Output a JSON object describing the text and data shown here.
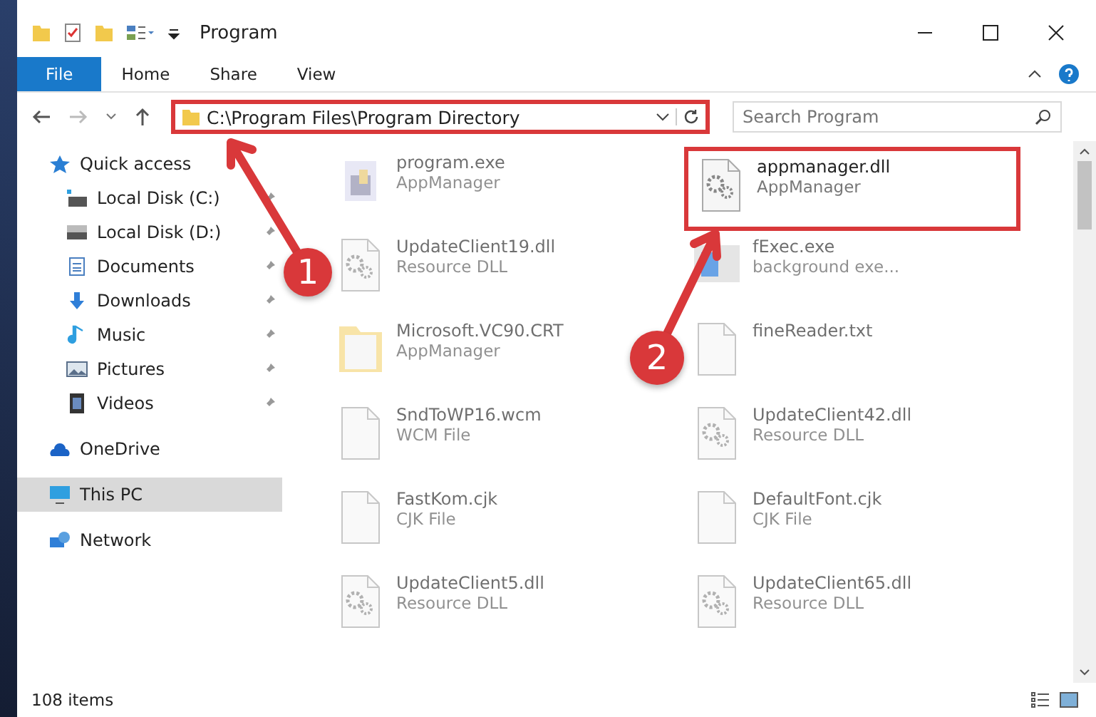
{
  "window": {
    "title": "Program"
  },
  "ribbon": {
    "tabs": [
      {
        "label": "File",
        "selected": true
      },
      {
        "label": "Home",
        "selected": false
      },
      {
        "label": "Share",
        "selected": false
      },
      {
        "label": "View",
        "selected": false
      }
    ]
  },
  "address_bar": {
    "path": "C:\\Program Files\\Program Directory",
    "highlighted": true
  },
  "search": {
    "placeholder": "Search Program"
  },
  "sidebar": {
    "items": [
      {
        "label": "Quick access",
        "kind": "star",
        "selected": false,
        "children": [
          {
            "label": "Local Disk (C:)",
            "kind": "drive-c",
            "pinned": true,
            "selected": false
          },
          {
            "label": "Local Disk (D:)",
            "kind": "drive",
            "pinned": true,
            "selected": false
          },
          {
            "label": "Documents",
            "kind": "documents",
            "pinned": true,
            "selected": false
          },
          {
            "label": "Downloads",
            "kind": "downloads",
            "pinned": true,
            "selected": false
          },
          {
            "label": "Music",
            "kind": "music",
            "pinned": true,
            "selected": false
          },
          {
            "label": "Pictures",
            "kind": "pictures",
            "pinned": true,
            "selected": false
          },
          {
            "label": "Videos",
            "kind": "videos",
            "pinned": true,
            "selected": false
          }
        ]
      },
      {
        "label": "OneDrive",
        "kind": "cloud",
        "selected": false
      },
      {
        "label": "This PC",
        "kind": "pc",
        "selected": true
      },
      {
        "label": "Network",
        "kind": "network",
        "selected": false
      }
    ]
  },
  "files": [
    {
      "name": "program.exe",
      "type": "AppManager",
      "kind": "exe",
      "highlighted": false
    },
    {
      "name": "appmanager.dll",
      "type": "AppManager",
      "kind": "gear",
      "highlighted": true
    },
    {
      "name": "UpdateClient19.dll",
      "type": "Resource DLL",
      "kind": "dll",
      "highlighted": false
    },
    {
      "name": "fExec.exe",
      "type": "background exe...",
      "kind": "window",
      "highlighted": false
    },
    {
      "name": "Microsoft.VC90.CRT",
      "type": "AppManager",
      "kind": "folder",
      "highlighted": false
    },
    {
      "name": "fineReader.txt",
      "kind": "blank",
      "highlighted": false
    },
    {
      "name": "SndToWP16.wcm",
      "type": "WCM File",
      "kind": "blank",
      "highlighted": false
    },
    {
      "name": "UpdateClient42.dll",
      "type": "Resource DLL",
      "kind": "dll",
      "highlighted": false
    },
    {
      "name": "FastKom.cjk",
      "type": "CJK File",
      "kind": "blank",
      "highlighted": false
    },
    {
      "name": "DefaultFont.cjk",
      "type": "CJK File",
      "kind": "blank",
      "highlighted": false
    },
    {
      "name": "UpdateClient5.dll",
      "type": "Resource DLL",
      "kind": "dll",
      "highlighted": false
    },
    {
      "name": "UpdateClient65.dll",
      "type": "Resource DLL",
      "kind": "dll",
      "highlighted": false
    }
  ],
  "annotations": [
    {
      "label": "1"
    },
    {
      "label": "2"
    }
  ],
  "status_bar": {
    "item_count": "108 items"
  }
}
